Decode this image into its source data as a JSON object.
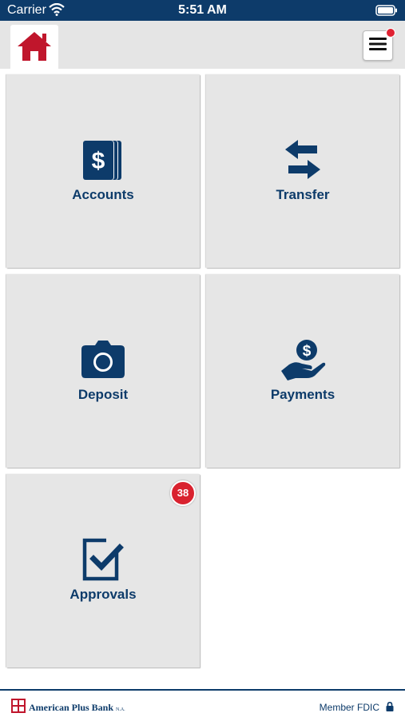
{
  "status_bar": {
    "carrier": "Carrier",
    "time": "5:51 AM",
    "icons": [
      "wifi-icon",
      "battery-icon"
    ]
  },
  "header": {
    "home_icon": "home-icon",
    "menu_icon": "hamburger-menu-icon",
    "has_notification": true
  },
  "tiles": [
    {
      "label": "Accounts",
      "icon": "accounts-dollar-icon"
    },
    {
      "label": "Transfer",
      "icon": "transfer-arrows-icon"
    },
    {
      "label": "Deposit",
      "icon": "camera-icon"
    },
    {
      "label": "Payments",
      "icon": "hand-coin-icon"
    },
    {
      "label": "Approvals",
      "icon": "checkbox-icon",
      "badge": "38"
    }
  ],
  "footer": {
    "bank_name": "American Plus Bank",
    "bank_suffix": "N.A.",
    "member_text": "Member FDIC",
    "lock_icon": "lock-icon"
  },
  "colors": {
    "navy": "#0d3b6a",
    "home_red": "#c0162c",
    "badge_red": "#d9222f",
    "tile_bg": "#e6e6e6",
    "topbar_bg": "#e5e5e5"
  }
}
